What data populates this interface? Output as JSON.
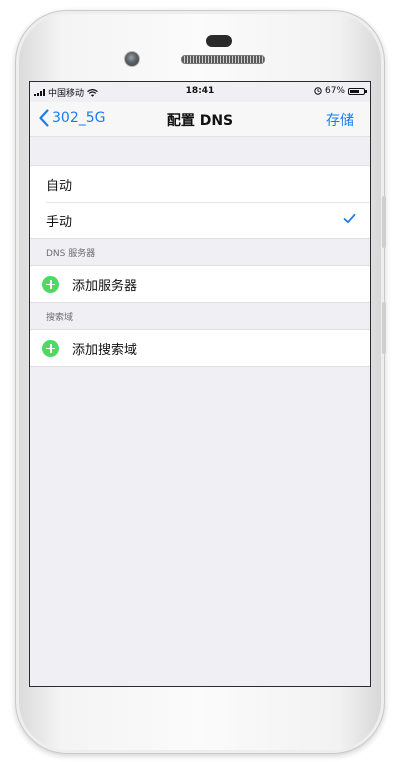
{
  "status": {
    "carrier": "中国移动",
    "time": "18:41",
    "battery": "67%",
    "battery_level": 0.67
  },
  "nav": {
    "back_label": "302_5G",
    "title": "配置 DNS",
    "save_label": "存储"
  },
  "mode_group": {
    "items": [
      {
        "label": "自动",
        "checked": false
      },
      {
        "label": "手动",
        "checked": true
      }
    ]
  },
  "dns_section": {
    "header": "DNS 服务器",
    "add_label": "添加服务器"
  },
  "search_section": {
    "header": "搜索域",
    "add_label": "添加搜索域"
  },
  "colors": {
    "accent": "#1a7cf2",
    "add_green": "#4cd964",
    "background": "#efeff4"
  },
  "icons": [
    "signal-icon",
    "wifi-icon",
    "alarm-icon",
    "battery-icon",
    "chevron-left-icon",
    "checkmark-icon",
    "add-circle-icon"
  ]
}
